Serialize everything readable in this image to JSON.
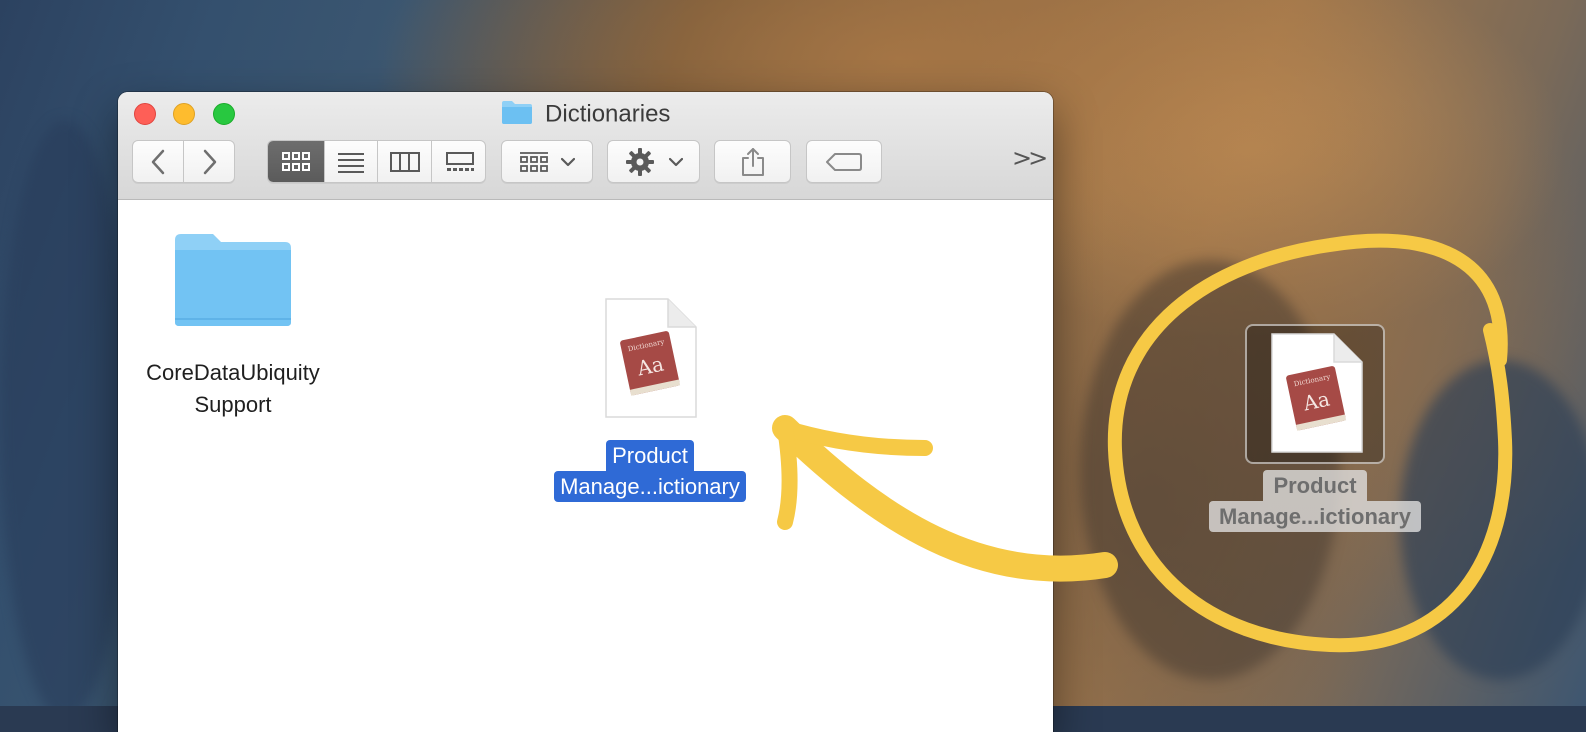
{
  "window": {
    "title": "Dictionaries"
  },
  "files": [
    {
      "name_line1": "CoreDataUbiquity",
      "name_line2": "Support",
      "kind": "folder"
    },
    {
      "name_line1": "Product",
      "name_line2": "Manage...ictionary",
      "kind": "dictionary",
      "selected": true
    }
  ],
  "dragged_item": {
    "name_line1": "Product",
    "name_line2": "Manage...ictionary"
  },
  "dictionary_icon": {
    "book_label": "Dictionary",
    "book_glyph": "Aa"
  },
  "toolbar": {
    "overflow_label": ">>"
  },
  "colors": {
    "selection": "#2f6ad6",
    "annotation": "#f6c945",
    "folder": "#7cc4f4"
  }
}
